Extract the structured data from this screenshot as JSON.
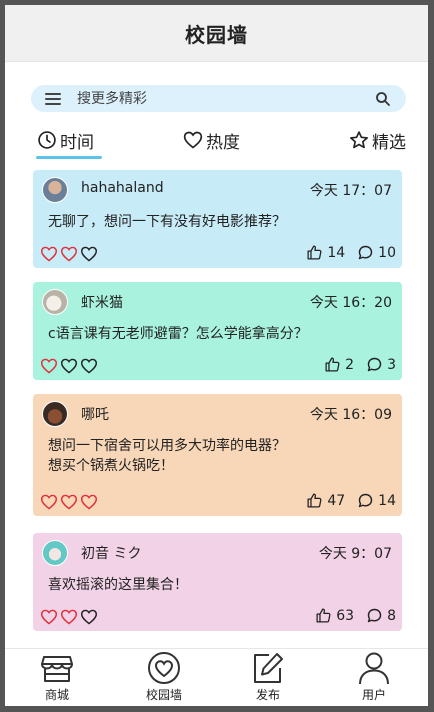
{
  "header": {
    "title": "校园墙"
  },
  "search": {
    "placeholder": "搜更多精彩"
  },
  "tabs": [
    {
      "label": "时间",
      "icon": "clock-icon",
      "active": true
    },
    {
      "label": "热度",
      "icon": "heart-outline-icon",
      "active": false
    },
    {
      "label": "精选",
      "icon": "star-outline-icon",
      "active": false
    }
  ],
  "posts": [
    {
      "author": "hahahaland",
      "time": "今天 17：07",
      "content": "无聊了，想问一下有没有好电影推荐？",
      "likes": "14",
      "comments": "10",
      "hearts_filled": 2,
      "color": "#c8ebf8"
    },
    {
      "author": "虾米猫",
      "time": "今天 16：20",
      "content": "c语言课有无老师避雷？怎么学能拿高分？",
      "likes": "2",
      "comments": "3",
      "hearts_filled": 1,
      "color": "#a8f2de"
    },
    {
      "author": "哪吒",
      "time": "今天 16：09",
      "content": "想问一下宿舍可以用多大功率的电器？\n想买个锅煮火锅吃！",
      "likes": "47",
      "comments": "14",
      "hearts_filled": 3,
      "color": "#f8d7b8"
    },
    {
      "author": "初音 ミク",
      "time": "今天 9：07",
      "content": "喜欢摇滚的这里集合！",
      "likes": "63",
      "comments": "8",
      "hearts_filled": 2,
      "color": "#f1d2e6"
    }
  ],
  "tabbar": [
    {
      "label": "商城",
      "icon": "shop-icon"
    },
    {
      "label": "校园墙",
      "icon": "heart-circle-icon"
    },
    {
      "label": "发布",
      "icon": "edit-icon"
    },
    {
      "label": "用户",
      "icon": "user-icon"
    }
  ],
  "colors": {
    "accent": "#5bc2ec",
    "heart": "#e0303a",
    "search_bg": "#dcf1fb"
  }
}
